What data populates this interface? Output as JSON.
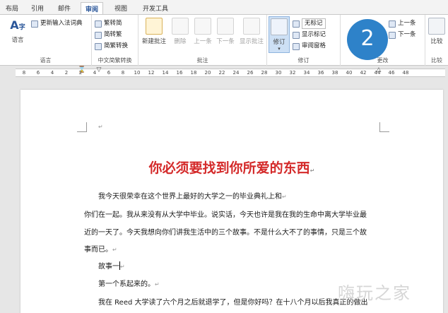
{
  "tabs": [
    "布局",
    "引用",
    "邮件",
    "审阅",
    "视图",
    "开发工具"
  ],
  "ribbon": {
    "language": {
      "translate_label": "语言",
      "update_ime_label": "更新输入法词典",
      "group_label": "语言"
    },
    "chinese_conversion": {
      "to_simplified": "繁转简",
      "to_traditional": "简转繁",
      "convert": "简繁转换",
      "group_label": "中文简繁转换"
    },
    "comments": {
      "new_comment": "新建批注",
      "delete": "删除",
      "previous": "上一条",
      "next": "下一条",
      "show_comments": "显示批注",
      "group_label": "批注"
    },
    "tracking": {
      "track_changes": "修订",
      "markup_select": "无标记",
      "show_markup": "显示标记",
      "reviewing_pane": "审阅窗格",
      "group_label": "修订"
    },
    "changes": {
      "previous": "上一条",
      "next": "下一条",
      "group_label": "更改"
    },
    "compare": {
      "compare_label": "比较",
      "group_label": "比较"
    }
  },
  "step_badge": "2",
  "ruler": {
    "numbers": [
      "8",
      "6",
      "4",
      "2",
      "2",
      "4",
      "6",
      "8",
      "10",
      "12",
      "14",
      "16",
      "18",
      "20",
      "22",
      "24",
      "26",
      "28",
      "30",
      "32",
      "34",
      "36",
      "38",
      "40",
      "42",
      "44",
      "46",
      "48"
    ]
  },
  "document": {
    "title": "你必须要找到你所爱的东西",
    "paragraphs": [
      "我今天很荣幸在这个世界上最好的大学之一的毕业典礼上和",
      "你们在一起。我从来没有从大学中毕业。说实话，今天也许是我在我的生命中离大学毕业最",
      "近的一天了。今天我想向你们讲我生活中的三个故事。不是什么大不了的事情，只是三个故",
      "事而已。",
      "故事一",
      "第一个系起来的。",
      "我在 Reed 大学读了六个月之后就退学了，但是你好吗？在十八个月以后我真正的做出"
    ]
  },
  "watermark": "嗨玩之家"
}
